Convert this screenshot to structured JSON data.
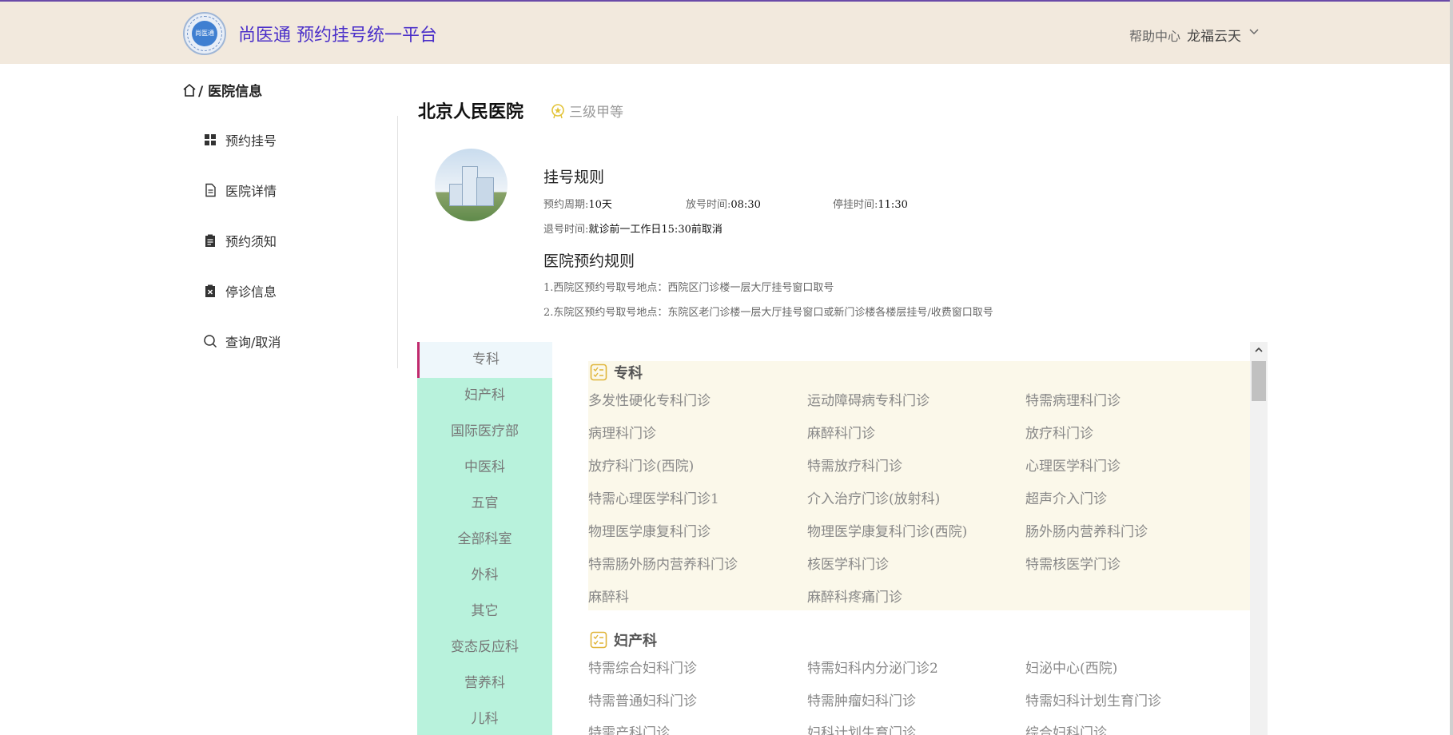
{
  "header": {
    "logo_text": "尚医通",
    "brand": "尚医通 预约挂号统一平台",
    "help": "帮助中心",
    "user": "龙福云天"
  },
  "sidebar": {
    "breadcrumb": "/ 医院信息",
    "items": [
      {
        "label": "预约挂号",
        "icon": "grid-icon"
      },
      {
        "label": "医院详情",
        "icon": "document-icon"
      },
      {
        "label": "预约须知",
        "icon": "clipboard-icon"
      },
      {
        "label": "停诊信息",
        "icon": "clipboard-x-icon"
      },
      {
        "label": "查询/取消",
        "icon": "search-icon"
      }
    ]
  },
  "hospital": {
    "name": "北京人民医院",
    "level": "三级甲等",
    "rules_title": "挂号规则",
    "cycle_label": "预约周期:",
    "cycle_value": "10天",
    "release_label": "放号时间:",
    "release_value": "08:30",
    "stop_label": "停挂时间:",
    "stop_value": "11:30",
    "quit_label": "退号时间:",
    "quit_value": "就诊前一工作日15:30前取消",
    "booking_rules_title": "医院预约规则",
    "booking_rules": [
      "1.西院区预约号取号地点：西院区门诊楼一层大厅挂号窗口取号",
      "2.东院区预约号取号地点：东院区老门诊楼一层大厅挂号窗口或新门诊楼各楼层挂号/收费窗口取号"
    ]
  },
  "dept_tabs": [
    "专科",
    "妇产科",
    "国际医疗部",
    "中医科",
    "五官",
    "全部科室",
    "外科",
    "其它",
    "变态反应科",
    "营养科",
    "儿科"
  ],
  "groups": [
    {
      "title": "专科",
      "depts": [
        "多发性硬化专科门诊",
        "运动障碍病专科门诊",
        "特需病理科门诊",
        "病理科门诊",
        "麻醉科门诊",
        "放疗科门诊",
        "放疗科门诊(西院)",
        "特需放疗科门诊",
        "心理医学科门诊",
        "特需心理医学科门诊1",
        "介入治疗门诊(放射科)",
        "超声介入门诊",
        "物理医学康复科门诊",
        "物理医学康复科门诊(西院)",
        "肠外肠内营养科门诊",
        "特需肠外肠内营养科门诊",
        "核医学科门诊",
        "特需核医学门诊",
        "麻醉科",
        "麻醉科疼痛门诊"
      ]
    },
    {
      "title": "妇产科",
      "depts": [
        "特需综合妇科门诊",
        "特需妇科内分泌门诊2",
        "妇泌中心(西院)",
        "特需普通妇科门诊",
        "特需肿瘤妇科门诊",
        "特需妇科计划生育门诊",
        "特需产科门诊",
        "妇科计划生育门诊",
        "综合妇科门诊"
      ]
    }
  ]
}
